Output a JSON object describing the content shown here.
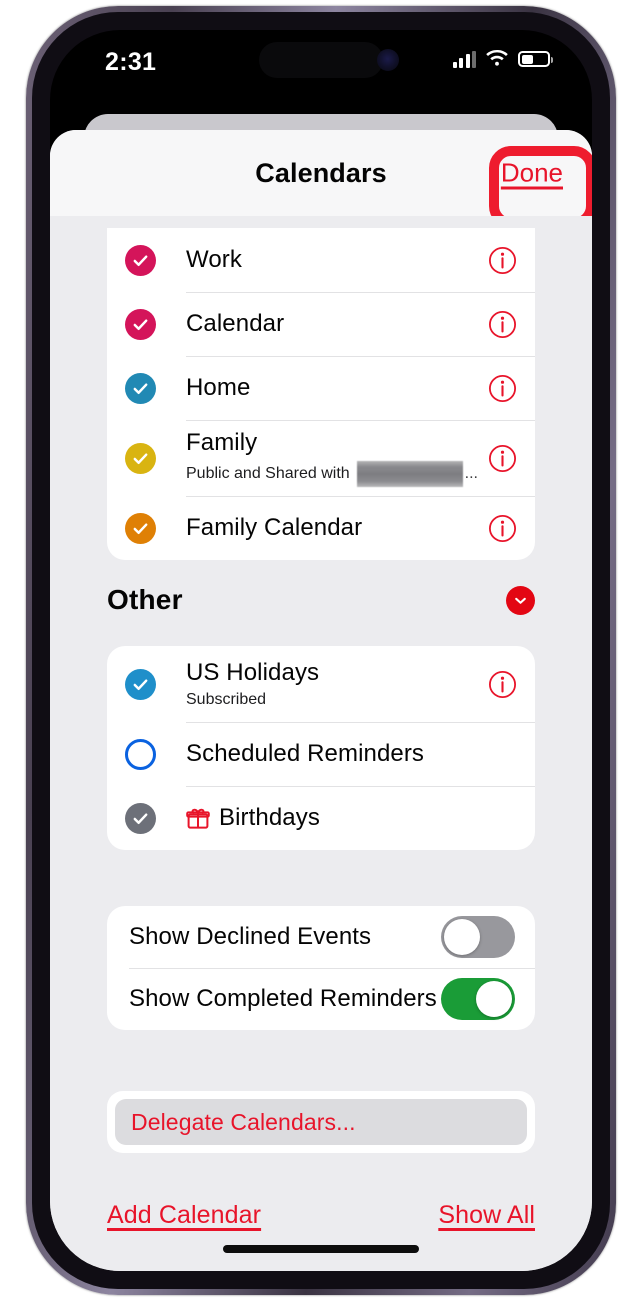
{
  "status_bar": {
    "time": "2:31",
    "cellular_icon": "cellular-bars-icon",
    "wifi_icon": "wifi-icon",
    "battery_icon": "battery-icon",
    "battery_level_percent": 45
  },
  "sheet": {
    "title": "Calendars",
    "done_label": "Done",
    "annotation": {
      "type": "rounded-rect-highlight",
      "color": "#ee1c2e",
      "target": "done-button"
    }
  },
  "calendars_section": {
    "rows": [
      {
        "title": "Work",
        "subtitle": "",
        "checked": true,
        "color": "#d4145a",
        "has_info": true
      },
      {
        "title": "Calendar",
        "subtitle": "",
        "checked": true,
        "color": "#d4145a",
        "has_info": true
      },
      {
        "title": "Home",
        "subtitle": "",
        "checked": true,
        "color": "#2189b4",
        "has_info": true
      },
      {
        "title": "Family",
        "subtitle_prefix": "Public and Shared with",
        "subtitle_redacted": true,
        "subtitle_suffix": "...",
        "checked": true,
        "color": "#d9b411",
        "has_info": true
      },
      {
        "title": "Family Calendar",
        "subtitle": "",
        "checked": true,
        "color": "#df8005",
        "has_info": true
      }
    ]
  },
  "other_section": {
    "header": "Other",
    "collapse_icon": "chevron-down-icon",
    "collapse_color": "#e30613",
    "rows": [
      {
        "title": "US Holidays",
        "subtitle": "Subscribed",
        "checked": true,
        "color": "#1f8fca",
        "has_info": true,
        "leading_icon": ""
      },
      {
        "title": "Scheduled Reminders",
        "subtitle": "",
        "checked": false,
        "color": "#0a62e0",
        "has_info": false,
        "leading_icon": ""
      },
      {
        "title": "Birthdays",
        "subtitle": "",
        "checked": true,
        "color": "#6d7079",
        "has_info": false,
        "leading_icon": "gift-icon"
      }
    ]
  },
  "toggles": [
    {
      "label": "Show Declined Events",
      "on": false,
      "off_color": "#98989d"
    },
    {
      "label": "Show Completed Reminders",
      "on": true,
      "on_color": "#1a9c37"
    }
  ],
  "delegate": {
    "label": "Delegate Calendars..."
  },
  "footer": {
    "add_calendar_label": "Add Calendar",
    "show_all_label": "Show All",
    "link_color": "#e8142a"
  }
}
